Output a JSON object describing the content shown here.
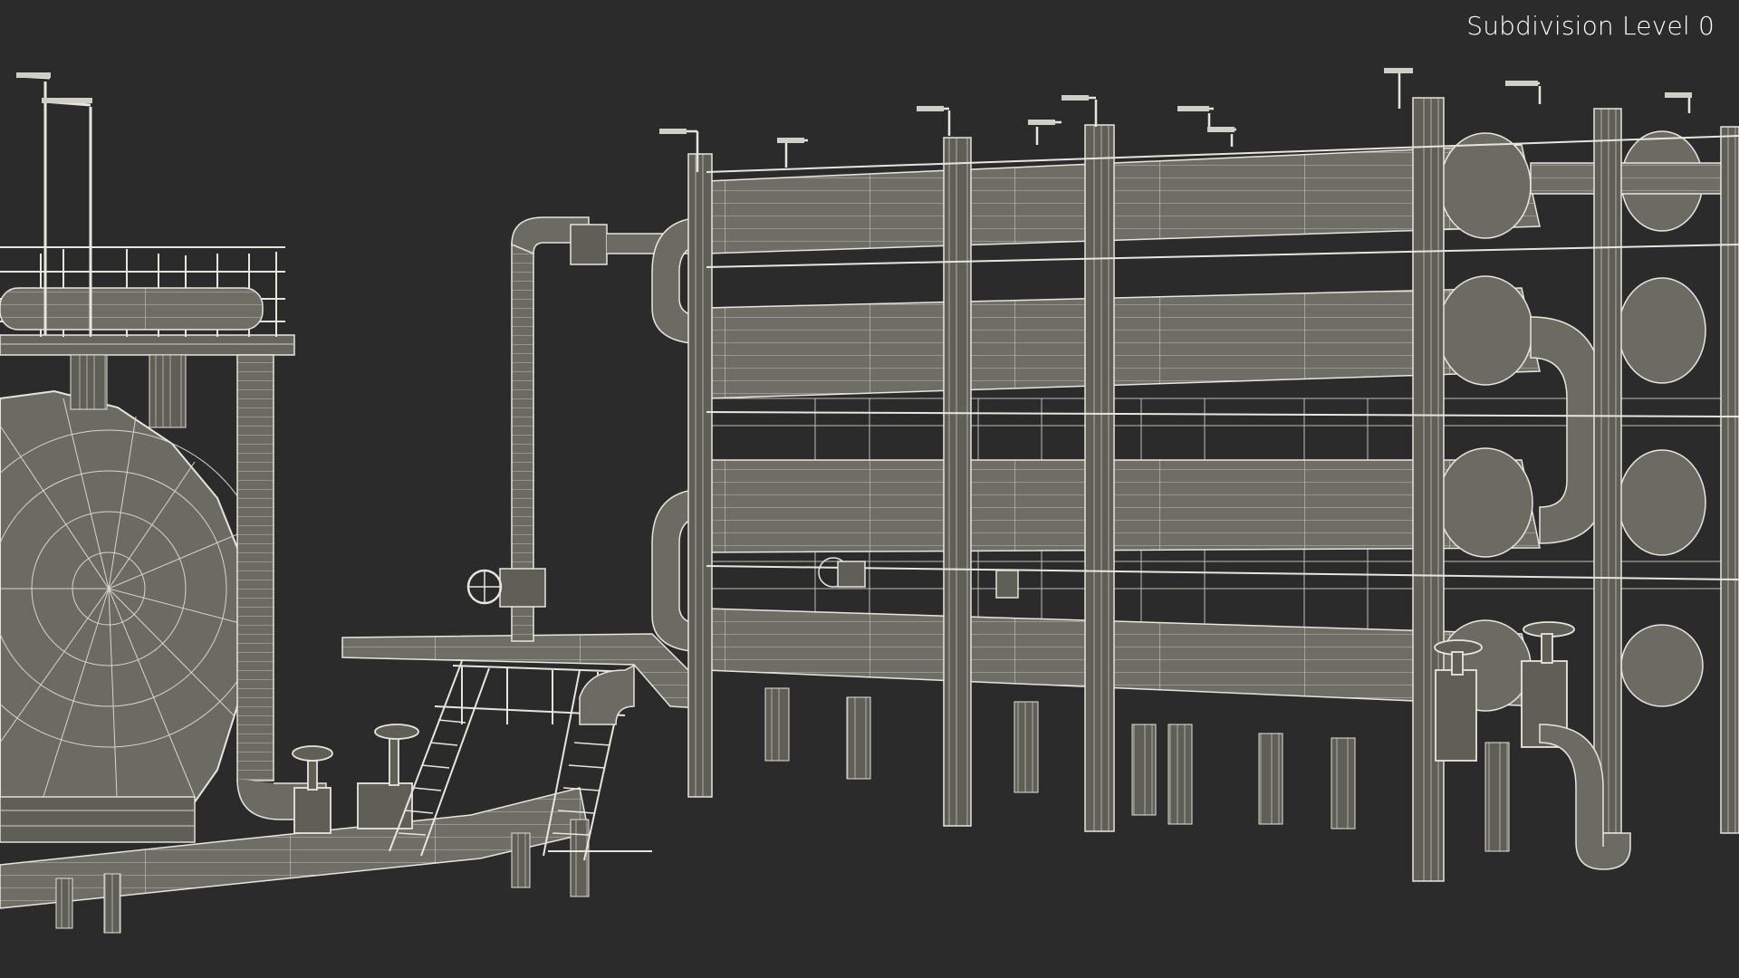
{
  "viewport": {
    "subdivision_label": "Subdivision Level 0",
    "background_color": "#2b2b2b",
    "model_fill_color": "#6b6b63",
    "model_wire_color": "#e8e8e0"
  }
}
